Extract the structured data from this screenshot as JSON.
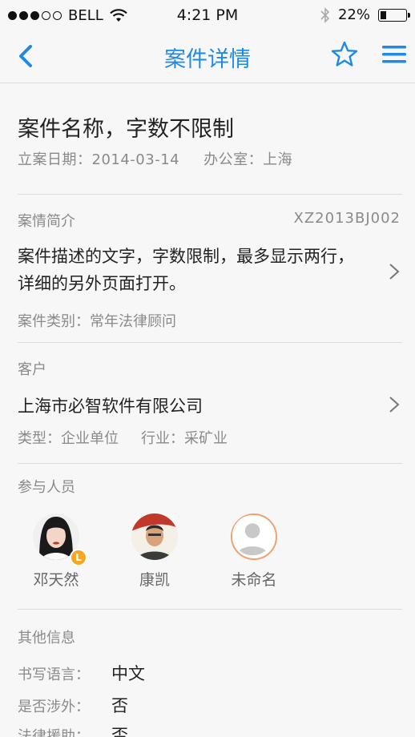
{
  "status_bar": {
    "carrier": "BELL",
    "time": "4:21 PM",
    "battery_percent": "22%",
    "battery_level": 0.22,
    "signal_dots_filled": 3,
    "signal_dots_total": 5
  },
  "nav": {
    "title": "案件详情",
    "back_icon": "chevron-left-icon",
    "favorite_icon": "star-outline-icon",
    "menu_icon": "hamburger-menu-icon",
    "accent_color": "#1e8ae6"
  },
  "case": {
    "title": "案件名称，字数不限制",
    "filing_date": "立案日期：2014-03-14",
    "office": "办公室：上海"
  },
  "summary": {
    "label": "案情简介",
    "case_number": "XZ2013BJ002",
    "description": "案件描述的文字，字数限制，最多显示两行，详细的另外页面打开。",
    "category": "案件类别：常年法律顾问"
  },
  "client": {
    "label": "客户",
    "name": "上海市必智软件有限公司",
    "type": "类型：企业单位",
    "industry": "行业：采矿业"
  },
  "participants": {
    "label": "参与人员",
    "people": [
      {
        "name": "邓天然",
        "badge": "L",
        "avatar": "female-portrait"
      },
      {
        "name": "康凯",
        "avatar": "male-portrait"
      },
      {
        "name": "未命名",
        "avatar": "default-person-icon"
      }
    ]
  },
  "other_info": {
    "label": "其他信息",
    "rows": [
      {
        "label": "书写语言：",
        "value": "中文"
      },
      {
        "label": "是否涉外：",
        "value": "否"
      },
      {
        "label": "法律援助：",
        "value": "否"
      }
    ]
  }
}
